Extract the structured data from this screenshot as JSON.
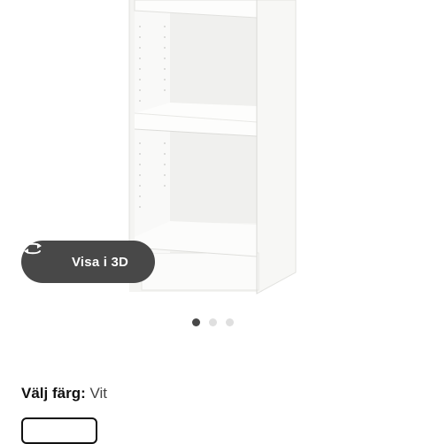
{
  "gallery": {
    "view3d_label": "Visa i 3D",
    "icon": "rotate-3d-icon",
    "dots": [
      "active",
      "inactive",
      "inactive"
    ]
  },
  "color_picker": {
    "label": "Välj färg:",
    "value": "Vit"
  }
}
